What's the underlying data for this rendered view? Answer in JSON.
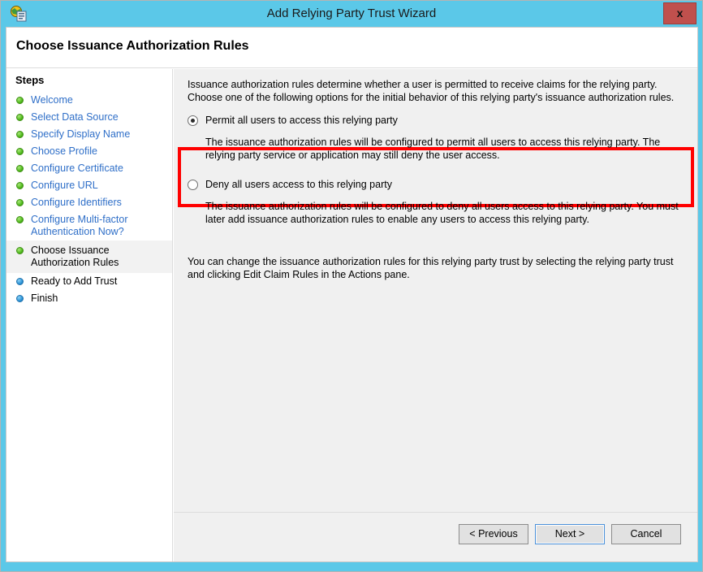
{
  "window": {
    "title": "Add Relying Party Trust Wizard",
    "icon": "relying-party-globe-icon",
    "close_label": "x",
    "frame_color": "#5bc8e8"
  },
  "header": {
    "page_title": "Choose Issuance Authorization Rules"
  },
  "sidebar": {
    "heading": "Steps",
    "items": [
      {
        "label": "Welcome",
        "state": "done"
      },
      {
        "label": "Select Data Source",
        "state": "done"
      },
      {
        "label": "Specify Display Name",
        "state": "done"
      },
      {
        "label": "Choose Profile",
        "state": "done"
      },
      {
        "label": "Configure Certificate",
        "state": "done"
      },
      {
        "label": "Configure URL",
        "state": "done"
      },
      {
        "label": "Configure Identifiers",
        "state": "done"
      },
      {
        "label": "Configure Multi-factor\nAuthentication Now?",
        "state": "done"
      },
      {
        "label": "Choose Issuance\nAuthorization Rules",
        "state": "current"
      },
      {
        "label": "Ready to Add Trust",
        "state": "future"
      },
      {
        "label": "Finish",
        "state": "future"
      }
    ]
  },
  "content": {
    "intro": "Issuance authorization rules determine whether a user is permitted to receive claims for the relying party. Choose one of the following options for the initial behavior of this relying party's issuance authorization rules.",
    "option1": {
      "label": "Permit all users to access this relying party",
      "selected": true,
      "description": "The issuance authorization rules will be configured to permit all users to access this relying party. The relying party service or application may still deny the user access."
    },
    "option2": {
      "label": "Deny all users access to this relying party",
      "selected": false,
      "description": "The issuance authorization rules will be configured to deny all users access to this relying party. You must later add issuance authorization rules to enable any users to access this relying party."
    },
    "footnote": "You can change the issuance authorization rules for this relying party trust by selecting the relying party trust and clicking Edit Claim Rules in the Actions pane.",
    "highlight_color": "#ff0000"
  },
  "buttons": {
    "previous": "< Previous",
    "next": "Next >",
    "cancel": "Cancel"
  }
}
